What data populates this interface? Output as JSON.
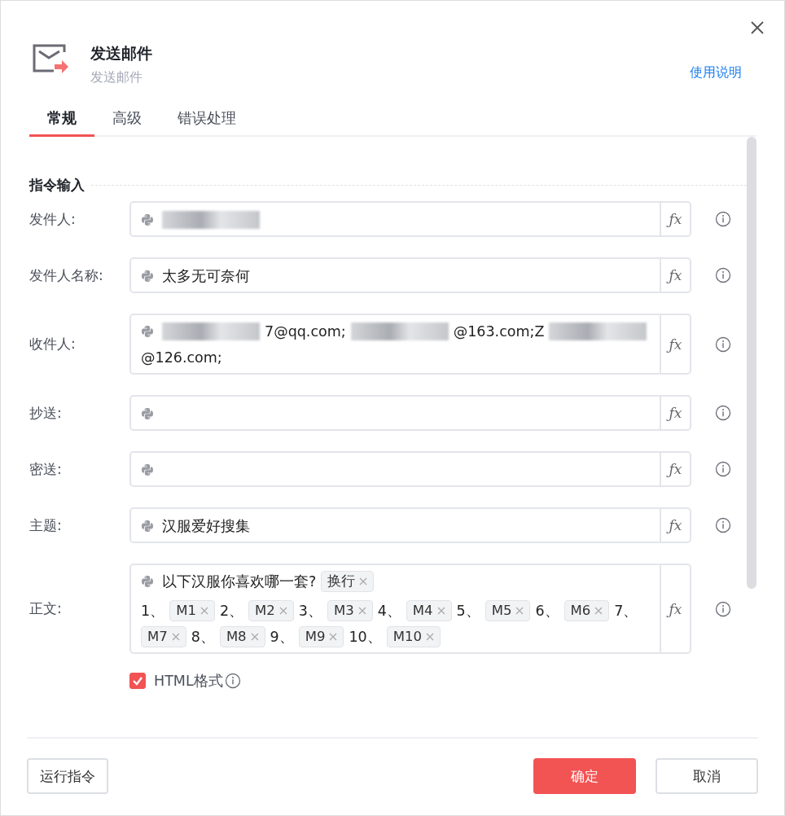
{
  "header": {
    "title": "发送邮件",
    "subtitle": "发送邮件",
    "help_link": "使用说明"
  },
  "tabs": [
    {
      "label": "常规",
      "selected": true
    },
    {
      "label": "高级",
      "selected": false
    },
    {
      "label": "错误处理",
      "selected": false
    }
  ],
  "section_title": "指令输入",
  "fields": [
    {
      "label": "发件人:",
      "segments": [
        {
          "kind": "redacted"
        }
      ]
    },
    {
      "label": "发件人名称:",
      "segments": [
        {
          "kind": "text",
          "text": "太多无可奈何"
        }
      ]
    },
    {
      "label": "收件人:",
      "segments": [
        {
          "kind": "redacted"
        },
        {
          "kind": "text",
          "text": "7@qq.com;"
        },
        {
          "kind": "redacted"
        },
        {
          "kind": "text",
          "text": "@163.com;Z"
        },
        {
          "kind": "redacted"
        },
        {
          "kind": "text",
          "text": "@126.com;"
        }
      ]
    },
    {
      "label": "抄送:"
    },
    {
      "label": "密送:"
    },
    {
      "label": "主题:",
      "segments": [
        {
          "kind": "text",
          "text": "汉服爱好搜集"
        }
      ]
    },
    {
      "label": "正文:",
      "segments": [
        {
          "kind": "text",
          "text": "以下汉服你喜欢哪一套?"
        },
        {
          "kind": "tag",
          "text": "换行"
        },
        {
          "kind": "break"
        },
        {
          "kind": "text",
          "text": "1、"
        },
        {
          "kind": "tag",
          "text": "M1"
        },
        {
          "kind": "text",
          "text": "2、"
        },
        {
          "kind": "tag",
          "text": "M2"
        },
        {
          "kind": "text",
          "text": "3、"
        },
        {
          "kind": "tag",
          "text": "M3"
        },
        {
          "kind": "text",
          "text": "4、"
        },
        {
          "kind": "tag",
          "text": "M4"
        },
        {
          "kind": "text",
          "text": "5、"
        },
        {
          "kind": "tag",
          "text": "M5"
        },
        {
          "kind": "text",
          "text": "6、"
        },
        {
          "kind": "tag",
          "text": "M6"
        },
        {
          "kind": "text",
          "text": "7、"
        },
        {
          "kind": "tag",
          "text": "M7"
        },
        {
          "kind": "text",
          "text": "8、"
        },
        {
          "kind": "tag",
          "text": "M8"
        },
        {
          "kind": "text",
          "text": "9、"
        },
        {
          "kind": "tag",
          "text": "M9"
        },
        {
          "kind": "text",
          "text": "10、"
        },
        {
          "kind": "tag",
          "text": "M10"
        }
      ]
    }
  ],
  "fx_labels": [
    "ƒx",
    "ƒx",
    "ƒx",
    "ƒx",
    "ƒx",
    "ƒx",
    "ƒx"
  ],
  "html_option": {
    "label": "HTML格式",
    "checked": true
  },
  "footer": {
    "run_button": "运行指令",
    "ok_button": "确定",
    "cancel_button": "取消"
  }
}
